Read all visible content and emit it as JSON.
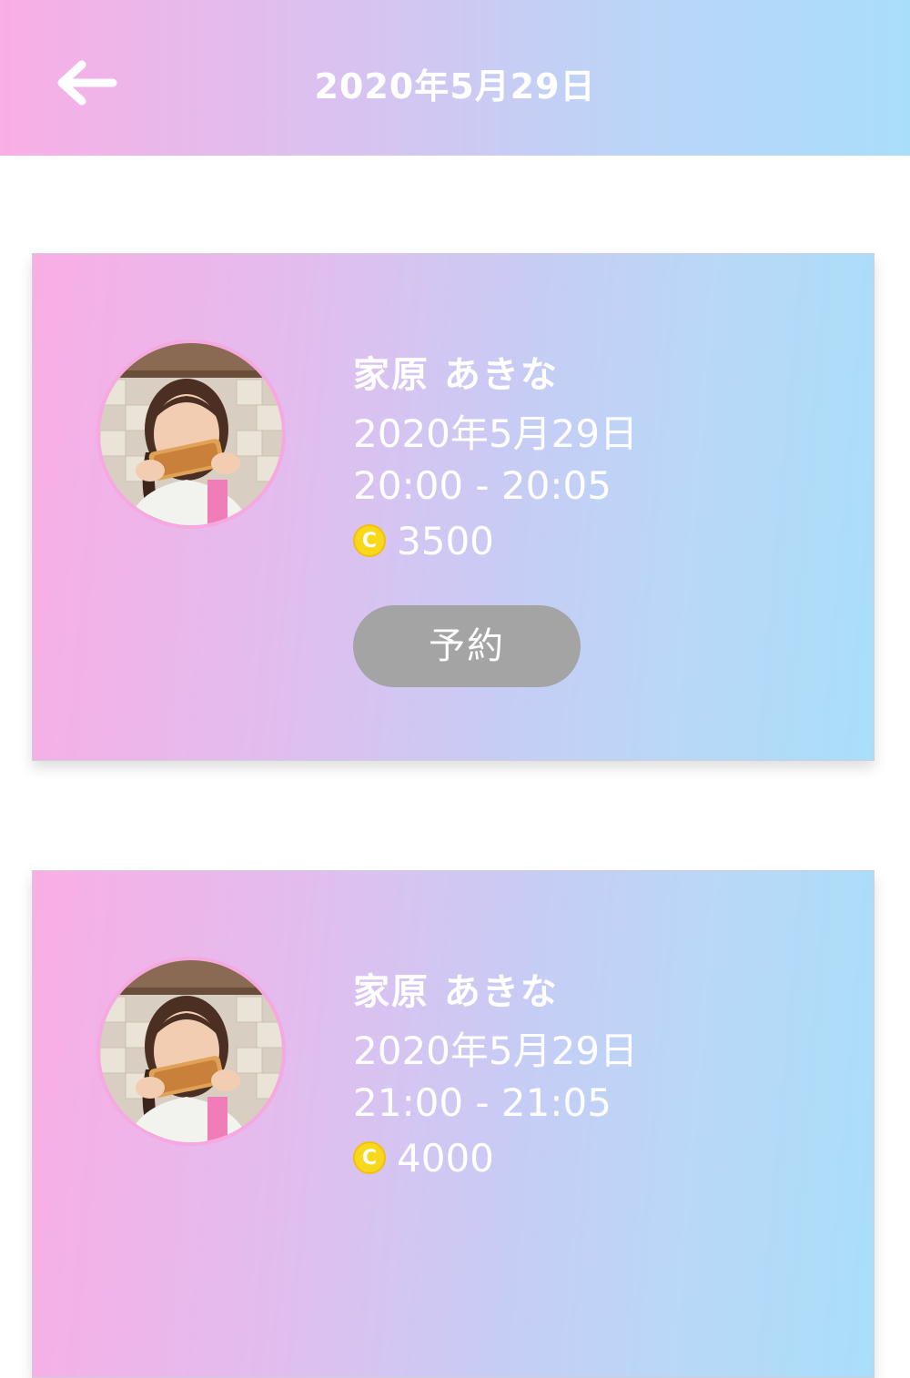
{
  "header": {
    "title": "2020年5月29日",
    "back_icon": "back-arrow-icon"
  },
  "slots": [
    {
      "name": "家原 あきな",
      "date": "2020年5月29日",
      "time": "20:00 - 20:05",
      "coin_icon": "coin-icon",
      "coin_symbol": "C",
      "price": "3500",
      "button_label": "予約"
    },
    {
      "name": "家原 あきな",
      "date": "2020年5月29日",
      "time": "21:00 - 21:05",
      "coin_icon": "coin-icon",
      "coin_symbol": "C",
      "price": "4000"
    }
  ],
  "colors": {
    "gradient_start": "#f9aee5",
    "gradient_end": "#a9def9",
    "button_gray": "#a4a4a4",
    "coin_yellow": "#f8d81a"
  }
}
